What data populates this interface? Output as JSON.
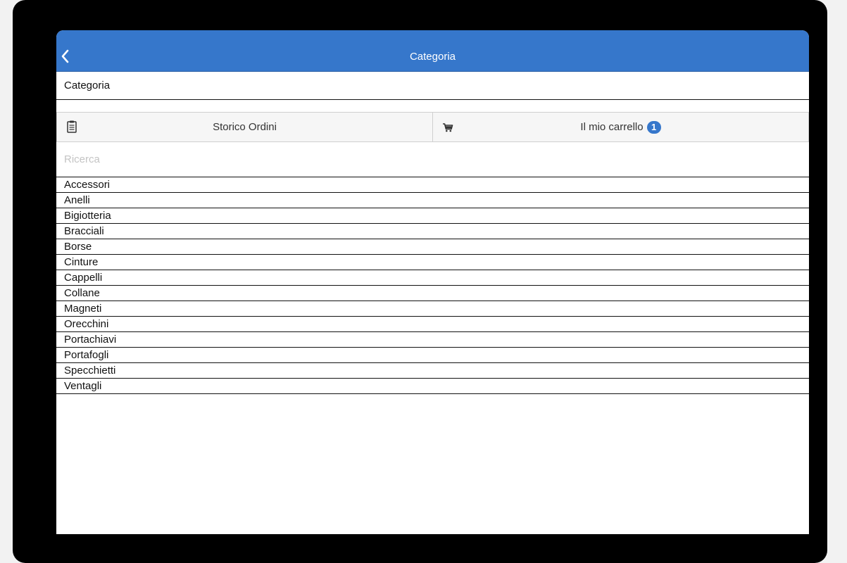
{
  "nav": {
    "title": "Categoria",
    "back_icon": "chevron-left-icon"
  },
  "section_header": "Categoria",
  "actions": {
    "order_history": {
      "label": "Storico Ordini",
      "icon": "clipboard-icon"
    },
    "cart": {
      "label": "Il mio carrello",
      "icon": "cart-icon",
      "badge_count": "1"
    }
  },
  "search": {
    "placeholder": "Ricerca",
    "value": ""
  },
  "categories": [
    "Accessori",
    "Anelli",
    "Bigiotteria",
    "Bracciali",
    "Borse",
    "Cinture",
    "Cappelli",
    "Collane",
    "Magneti",
    "Orecchini",
    "Portachiavi",
    "Portafogli",
    "Specchietti",
    "Ventagli"
  ],
  "colors": {
    "accent": "#3677cb",
    "frame": "#000000",
    "background": "#f2f2f2"
  }
}
